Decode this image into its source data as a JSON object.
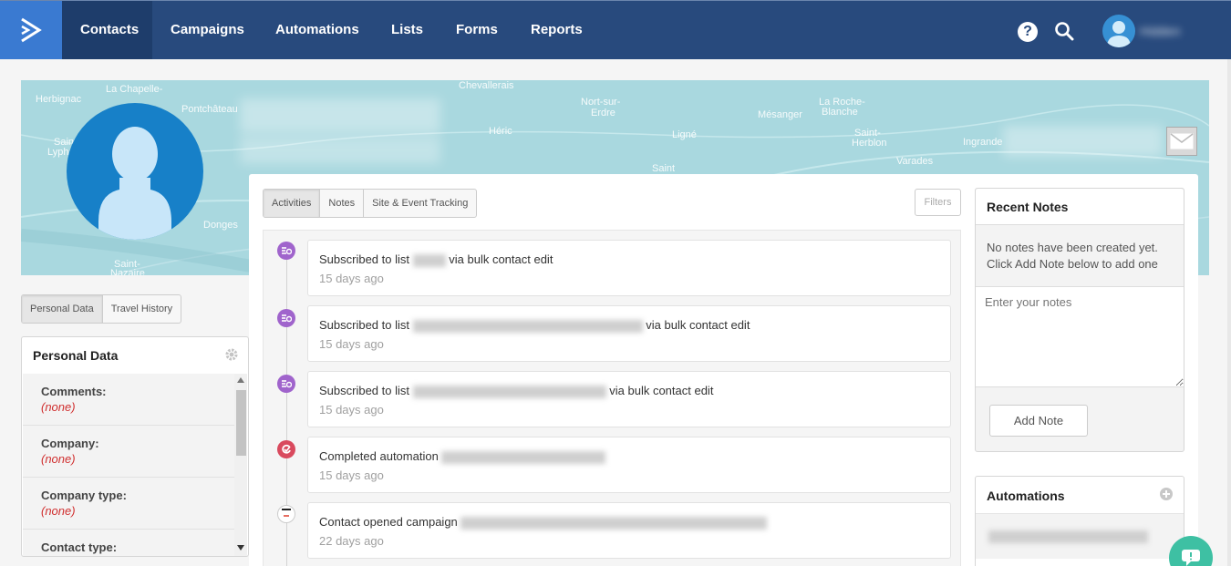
{
  "nav": {
    "items": [
      {
        "label": "Contacts",
        "active": true
      },
      {
        "label": "Campaigns"
      },
      {
        "label": "Automations"
      },
      {
        "label": "Lists"
      },
      {
        "label": "Forms"
      },
      {
        "label": "Reports"
      }
    ],
    "help_label": "?",
    "user_name": "Hidden"
  },
  "banner": {
    "map_labels": [
      "Herbignac",
      "La Chapelle-",
      "Pontchâteau",
      "Chevallerais",
      "Nort-sur-",
      "Erdre",
      "Héric",
      "Mésanger",
      "La Roche-",
      "Blanche",
      "Ligné",
      "Saint-",
      "Herblon",
      "Ingrande",
      "Varades",
      "Saint",
      "Donges",
      "Saint-",
      "Nazaire",
      "Saint-",
      "Lyphard"
    ]
  },
  "left_tabs": {
    "personal": "Personal Data",
    "travel": "Travel History"
  },
  "personal_data": {
    "title": "Personal Data",
    "fields": [
      {
        "label": "Comments:",
        "value": "(none)"
      },
      {
        "label": "Company:",
        "value": "(none)"
      },
      {
        "label": "Company type:",
        "value": "(none)"
      },
      {
        "label": "Contact type:",
        "value": ""
      }
    ]
  },
  "center_tabs": {
    "activities": "Activities",
    "notes": "Notes",
    "tracking": "Site & Event Tracking",
    "filters": "Filters"
  },
  "activities": [
    {
      "prefix": "Subscribed to list",
      "suffix": "via bulk contact edit",
      "time": "15 days ago",
      "color": "#9b59c9"
    },
    {
      "prefix": "Subscribed to list",
      "suffix": "via bulk contact edit",
      "time": "15 days ago",
      "color": "#9b59c9"
    },
    {
      "prefix": "Subscribed to list",
      "suffix": "via bulk contact edit",
      "time": "15 days ago",
      "color": "#9b59c9"
    },
    {
      "prefix": "Completed automation",
      "suffix": "",
      "time": "15 days ago",
      "color": "#d94a5e"
    },
    {
      "prefix": "Contact opened campaign",
      "suffix": "",
      "time": "22 days ago",
      "color": "#ffffff"
    }
  ],
  "recent_notes": {
    "title": "Recent Notes",
    "empty": "No notes have been created yet. Click Add Note below to add one",
    "placeholder": "Enter your notes",
    "add_button": "Add Note"
  },
  "automations": {
    "title": "Automations"
  }
}
